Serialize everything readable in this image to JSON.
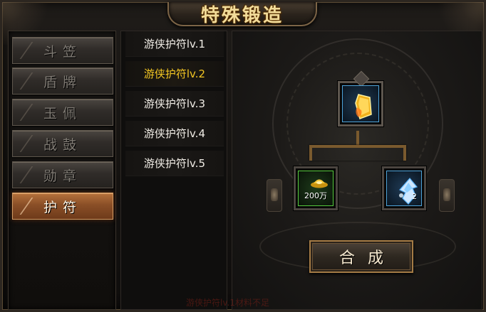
{
  "title": "特殊锻造",
  "categories": [
    {
      "label": "斗笠",
      "active": false
    },
    {
      "label": "盾牌",
      "active": false
    },
    {
      "label": "玉佩",
      "active": false
    },
    {
      "label": "战鼓",
      "active": false
    },
    {
      "label": "勋章",
      "active": false
    },
    {
      "label": "护符",
      "active": true
    }
  ],
  "items": [
    {
      "label": "游侠护符lv.1",
      "selected": false
    },
    {
      "label": "游侠护符lv.2",
      "selected": true
    },
    {
      "label": "游侠护符lv.3",
      "selected": false
    },
    {
      "label": "游侠护符lv.4",
      "selected": false
    },
    {
      "label": "游侠护符lv.5",
      "selected": false
    }
  ],
  "forge": {
    "target_icon": "golden-amulet-icon",
    "materials": [
      {
        "icon": "gold-ingot-icon",
        "amount": "200万"
      },
      {
        "icon": "blue-wing-icon",
        "count": "2"
      }
    ],
    "compose_label": "合成"
  },
  "footer_warning": "游侠护符lv.1材料不足",
  "colors": {
    "accent_orange": "#8a4f27",
    "selected_text": "#f3c623",
    "rare_blue": "#4da3d9",
    "uncommon_green": "#54c93c"
  }
}
